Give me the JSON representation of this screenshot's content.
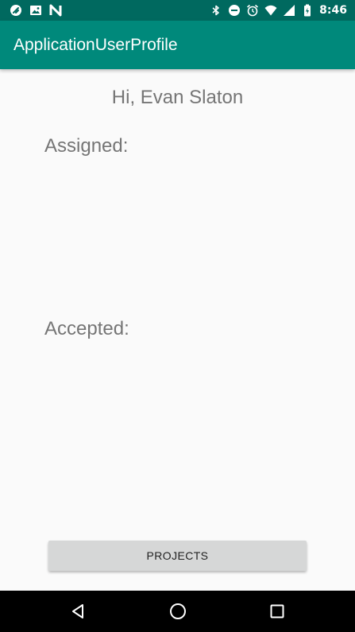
{
  "status_bar": {
    "time": "8:46",
    "left_icons": [
      "app-notification-icon",
      "image-notification-icon",
      "n-notification-icon"
    ],
    "right_icons": [
      "bluetooth-icon",
      "do-not-disturb-icon",
      "alarm-icon",
      "wifi-icon",
      "signal-icon",
      "battery-icon"
    ]
  },
  "app_bar": {
    "title": "ApplicationUserProfile",
    "color": "#00897b"
  },
  "profile": {
    "greeting": "Hi, Evan Slaton",
    "assigned_label": "Assigned:",
    "accepted_label": "Accepted:"
  },
  "actions": {
    "projects_label": "PROJECTS"
  },
  "nav_bar": {
    "icons": [
      "back-icon",
      "home-icon",
      "recents-icon"
    ]
  }
}
